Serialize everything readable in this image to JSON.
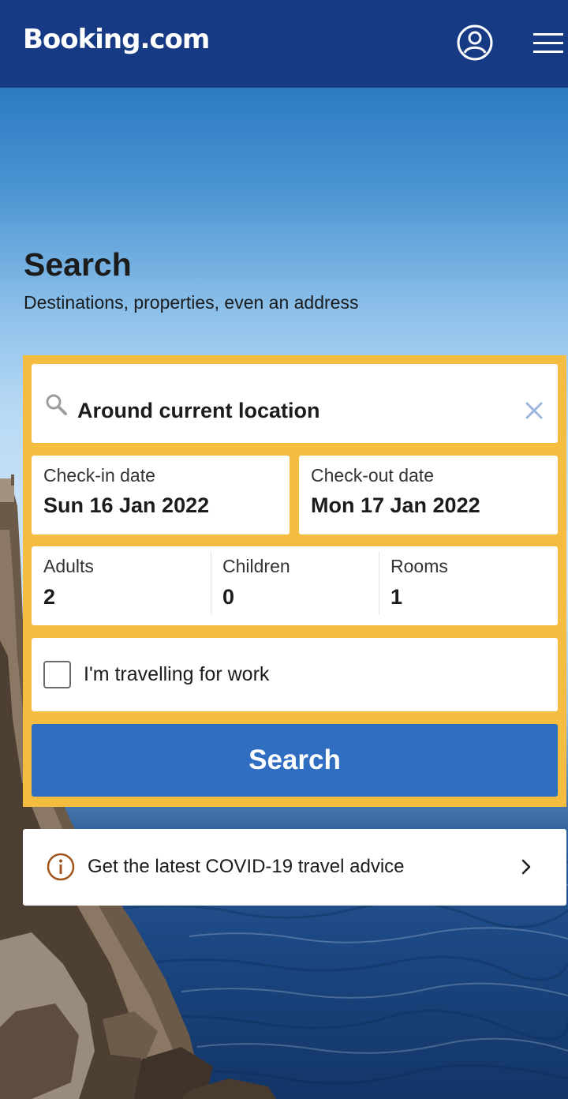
{
  "header": {
    "logo": "Booking.com",
    "background_color": "#163a84",
    "icons": {
      "account": "account-circle-icon",
      "menu": "hamburger-menu-icon"
    }
  },
  "search": {
    "title": "Search",
    "subtitle": "Destinations, properties, even an address",
    "destination": {
      "value": "Around current location",
      "icon": "search-icon",
      "clear_icon": "close-icon"
    },
    "check_in": {
      "label": "Check-in date",
      "value": "Sun 16 Jan 2022"
    },
    "check_out": {
      "label": "Check-out date",
      "value": "Mon 17 Jan 2022"
    },
    "guests": {
      "adults": {
        "label": "Adults",
        "value": "2"
      },
      "children": {
        "label": "Children",
        "value": "0"
      },
      "rooms": {
        "label": "Rooms",
        "value": "1"
      }
    },
    "work_travel": {
      "label": "I'm travelling for work",
      "checked": false
    },
    "button_label": "Search",
    "box_color": "#f5bd40",
    "button_color": "#2f6ec0"
  },
  "covid_banner": {
    "text": "Get the latest COVID-19 travel advice",
    "icon": "info-icon",
    "chevron": "chevron-right-icon",
    "icon_color": "#a0561c"
  }
}
